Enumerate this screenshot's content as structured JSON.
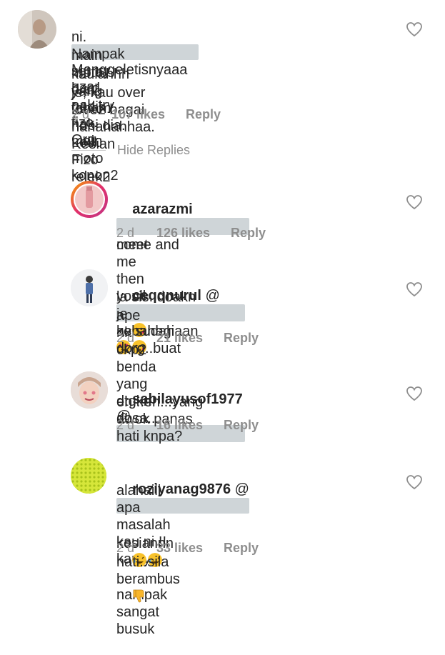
{
  "comments": [
    {
      "id": "c0",
      "username": "",
      "text_lines": [
        "Menggeletisnyaaa azar",
        "ni. Nampak sgt try hard nak try fizo. Org",
        "main moto dia gedik nak main moto konon2",
        "kaulahhh yang faham hobi dia. Lolll. Fizo relek2",
        "je, kau over love2 bagai hahahahhaa. Kesian"
      ],
      "time": "2 d",
      "likes": "107 likes",
      "reply": "Reply"
    },
    {
      "id": "c1",
      "username": "azarazmi",
      "text_lines": [
        "come and",
        "meet me then youll know..."
      ],
      "emojis": [
        "kiss-emoji",
        "heart-eyes-emoji",
        "kiss-emoji"
      ],
      "time": "2 d",
      "likes": "126 likes",
      "reply": "Reply"
    },
    {
      "id": "c2",
      "username": "ceqqnurul",
      "mention_prefix": "@",
      "text_lines": [
        "as sudah",
        "la sis..doakn je kebahagiaan dorg..buat",
        "ape nk ckp2 benda yang dtgkn dosa..."
      ],
      "time": "2 d",
      "likes": "21 likes",
      "reply": "Reply"
    },
    {
      "id": "c3",
      "username": "sabilayusof1977",
      "mention_prefix": "@",
      "text_lines": [
        "eh...eh...yang awok panas hati knpa?"
      ],
      "time": "2 d",
      "likes": "16 likes",
      "reply": "Reply"
    },
    {
      "id": "c4",
      "username": "roziyanag9876",
      "mention_prefix": "@",
      "text_lines": [
        "alahaiii  apa masalah kau ni !! kau yg",
        "kesiannn",
        "nampak sangat busuk",
        "hati..sila berambus"
      ],
      "emojis": [
        "rofl-emoji",
        "rofl-emoji",
        "thumbs-down-emoji"
      ],
      "time": "2 d",
      "likes": "33 likes",
      "reply": "Reply"
    }
  ],
  "hide_replies_label": "Hide Replies",
  "colors": {
    "meta": "#8e8e8e",
    "text": "#262626",
    "blur": "#cfd5d8"
  }
}
